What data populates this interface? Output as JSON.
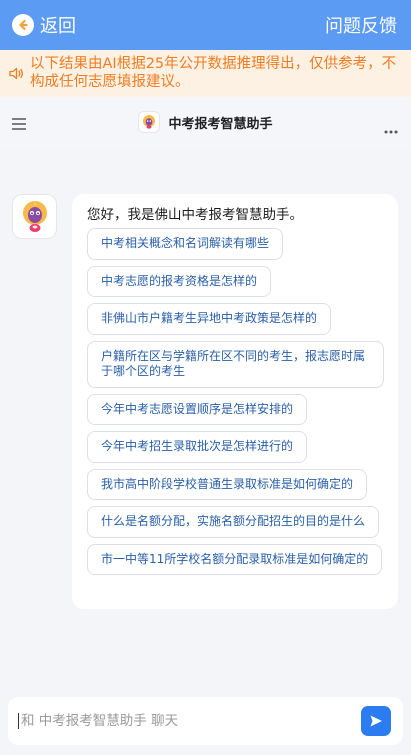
{
  "topbar": {
    "back_label": "返回",
    "feedback_label": "问题反馈"
  },
  "notice": {
    "text": "以下结果由AI根据25年公开数据推理得出，仅供参考，不构成任何志愿填报建议。"
  },
  "header": {
    "title": "中考报考智慧助手"
  },
  "chat": {
    "greeting": "您好，我是佛山中考报考智慧助手。",
    "suggestions": [
      "中考相关概念和名词解读有哪些",
      "中考志愿的报考资格是怎样的",
      "非佛山市户籍考生异地中考政策是怎样的",
      "户籍所在区与学籍所在区不同的考生，报志愿时属于哪个区的考生",
      "今年中考志愿设置顺序是怎样安排的",
      "今年中考招生录取批次是怎样进行的",
      "我市高中阶段学校普通生录取标准是如何确定的",
      "什么是名额分配，实施名额分配招生的目的是什么",
      "市一中等11所学校名额分配录取标准是如何确定的"
    ]
  },
  "input": {
    "placeholder": "和 中考报考智慧助手 聊天"
  },
  "colors": {
    "topbar": "#5b9bf3",
    "notice_text": "#f07d21",
    "send_button": "#2b7cf0"
  }
}
